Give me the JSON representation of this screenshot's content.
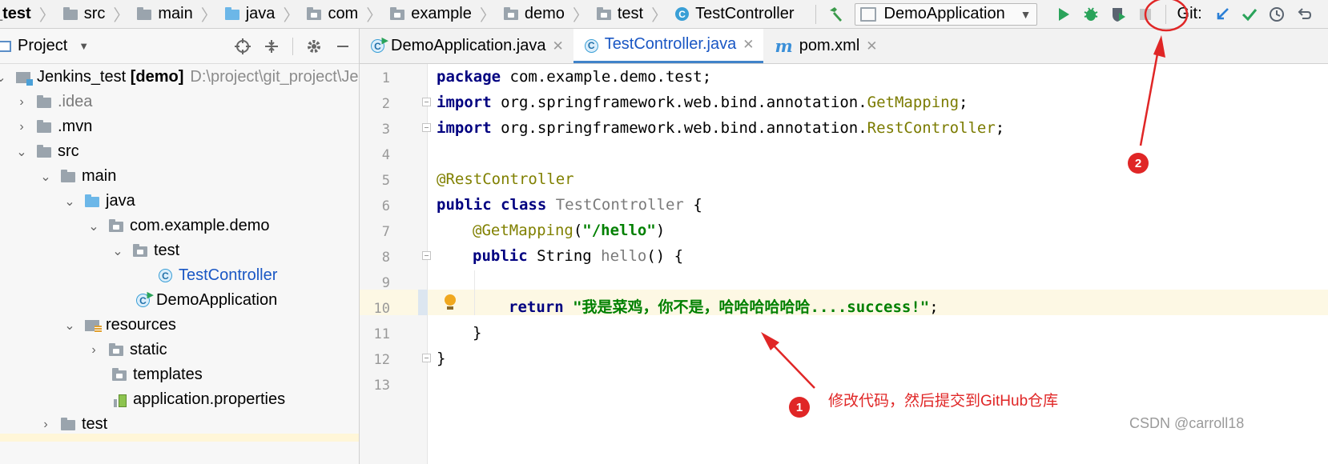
{
  "breadcrumbs": [
    {
      "label": "_test",
      "icon": "module-icon"
    },
    {
      "label": "src",
      "icon": "folder-icon"
    },
    {
      "label": "main",
      "icon": "folder-icon"
    },
    {
      "label": "java",
      "icon": "source-folder-icon"
    },
    {
      "label": "com",
      "icon": "package-icon"
    },
    {
      "label": "example",
      "icon": "package-icon"
    },
    {
      "label": "demo",
      "icon": "package-icon"
    },
    {
      "label": "test",
      "icon": "package-icon"
    },
    {
      "label": "TestController",
      "icon": "java-class-icon"
    }
  ],
  "toolbar": {
    "run_config": "DemoApplication",
    "git_label": "Git:",
    "icons": [
      "build-hammer-icon",
      "run-icon",
      "debug-icon",
      "coverage-icon",
      "stop-icon",
      "vcs-update-icon",
      "vcs-commit-icon",
      "vcs-history-icon",
      "vcs-rollback-icon"
    ],
    "colors": {
      "run": "#2aa35a",
      "commit": "#2aa35a",
      "update": "#2b7fd6",
      "build": "#3a9a4a"
    }
  },
  "project_panel": {
    "title": "Project",
    "tree": [
      {
        "label": "Jenkins_test ",
        "bold": "[demo]",
        "path": "D:\\project\\git_project\\Je",
        "icon": "module-folder-icon",
        "expanded": true
      },
      {
        "label": ".idea",
        "icon": "folder-icon",
        "expanded": false
      },
      {
        "label": ".mvn",
        "icon": "folder-icon",
        "expanded": false
      },
      {
        "label": "src",
        "icon": "folder-icon",
        "expanded": true
      },
      {
        "label": "main",
        "icon": "folder-icon",
        "expanded": true
      },
      {
        "label": "java",
        "icon": "source-folder-icon",
        "expanded": true
      },
      {
        "label": "com.example.demo",
        "icon": "package-icon",
        "expanded": true
      },
      {
        "label": "test",
        "icon": "package-icon",
        "expanded": true
      },
      {
        "label": "TestController",
        "icon": "java-class-icon"
      },
      {
        "label": "DemoApplication",
        "icon": "spring-app-class-icon"
      },
      {
        "label": "resources",
        "icon": "resources-folder-icon",
        "expanded": true
      },
      {
        "label": "static",
        "icon": "package-icon",
        "expanded": false
      },
      {
        "label": "templates",
        "icon": "package-icon"
      },
      {
        "label": "application.properties",
        "icon": "properties-file-icon"
      },
      {
        "label": "test",
        "icon": "folder-icon",
        "expanded": false
      }
    ]
  },
  "editor": {
    "tabs": [
      {
        "label": "DemoApplication.java",
        "icon": "spring-app-class-icon",
        "active": false
      },
      {
        "label": "TestController.java",
        "icon": "java-class-icon",
        "active": true
      },
      {
        "label": "pom.xml",
        "icon": "maven-icon",
        "active": false
      }
    ],
    "line_numbers": [
      "1",
      "2",
      "3",
      "4",
      "5",
      "6",
      "7",
      "8",
      "9",
      "10",
      "11",
      "12",
      "13"
    ],
    "current_line": 10,
    "code": {
      "l1_kw": "package",
      "l1_rest": " com.example.demo.test;",
      "l2_kw": "import",
      "l2_pkg": " org.springframework.web.bind.annotation.",
      "l2_cls": "GetMapping",
      "l2_end": ";",
      "l3_kw": "import",
      "l3_pkg": " org.springframework.web.bind.annotation.",
      "l3_cls": "RestController",
      "l3_end": ";",
      "l5_ann": "@RestController",
      "l6_kw": "public class",
      "l6_name": " TestController",
      "l6_end": " {",
      "l7_ann": "@GetMapping",
      "l7_open": "(",
      "l7_str": "\"/hello\"",
      "l7_close": ")",
      "l8_kw": "public",
      "l8_type": " String",
      "l8_name": " hello",
      "l8_end": "() {",
      "l10_kw": "return",
      "l10_str": "\"我是菜鸡，你不是，哈哈哈哈哈哈....success!\"",
      "l10_end": ";",
      "l11": "}",
      "l12": "}"
    }
  },
  "annotations": {
    "badge1": "1",
    "badge2": "2",
    "note": "修改代码，然后提交到GitHub仓库",
    "color": "#e02626"
  },
  "watermark": "CSDN @carroll18"
}
